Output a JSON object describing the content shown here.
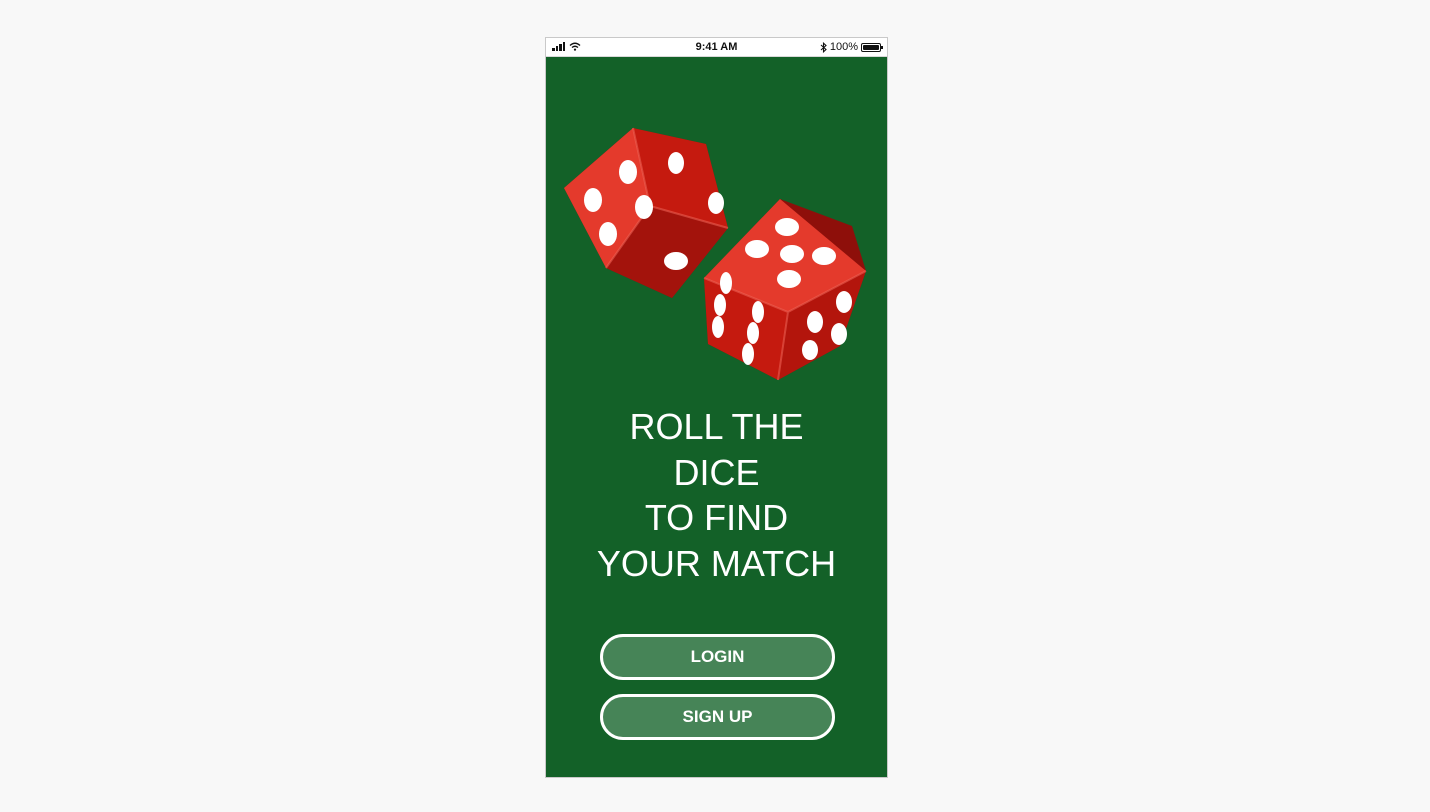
{
  "status_bar": {
    "time": "9:41 AM",
    "battery": "100%",
    "battery_level": 1.0,
    "icons": [
      "signal-icon",
      "wifi-icon",
      "bluetooth-icon",
      "battery-icon"
    ]
  },
  "hero": {
    "image": "dice-icon",
    "headline_lines": [
      "ROLL THE",
      "DICE",
      "TO FIND",
      "YOUR MATCH"
    ]
  },
  "actions": {
    "login_label": "LOGIN",
    "signup_label": "SIGN UP"
  },
  "colors": {
    "background": "#136128",
    "button_fill": "#468457",
    "button_border": "#ffffff",
    "dice_red": "#d9190f",
    "pip_white": "#ffffff"
  }
}
